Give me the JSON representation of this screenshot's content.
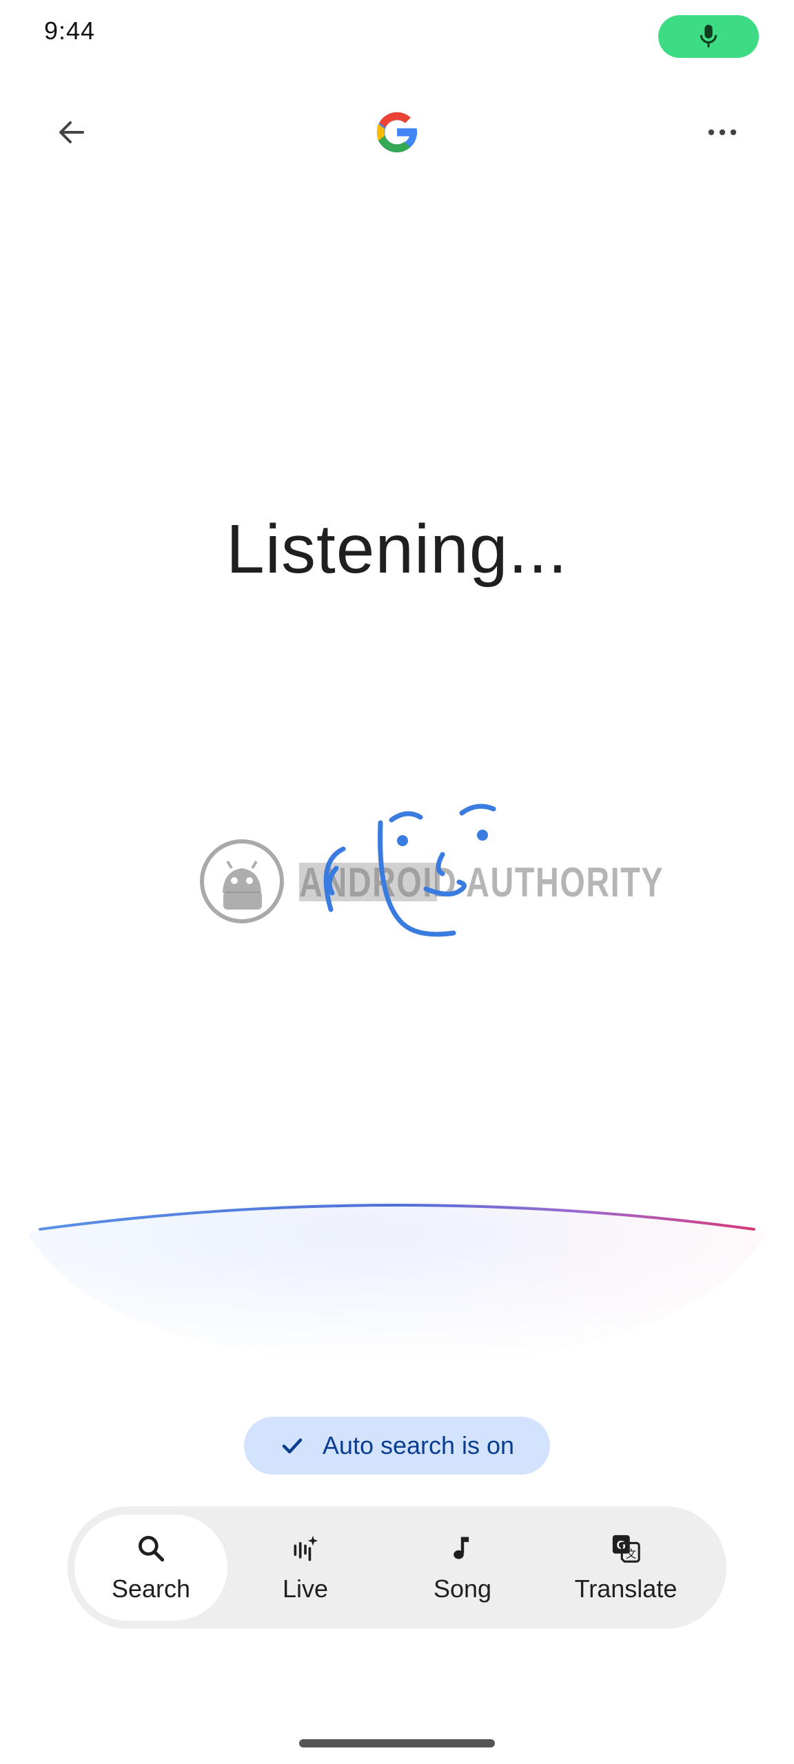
{
  "status_bar": {
    "time": "9:44",
    "mic_indicator_icon": "microphone-icon",
    "mic_indicator_color": "#3ddc84"
  },
  "app_bar": {
    "back_icon": "arrow-back-icon",
    "logo": "google-g-logo",
    "more_icon": "more-horizontal-icon"
  },
  "main": {
    "status_text": "Listening..."
  },
  "watermark": {
    "text": "ANDROID AUTHORITY"
  },
  "auto_search_chip": {
    "icon": "check-icon",
    "label": "Auto search is on",
    "background": "#d3e3fd",
    "text_color": "#0b3d91"
  },
  "modes": [
    {
      "label": "Search",
      "icon": "search-icon",
      "selected": true
    },
    {
      "label": "Live",
      "icon": "live-sparkle-icon",
      "selected": false
    },
    {
      "label": "Song",
      "icon": "music-note-icon",
      "selected": false
    },
    {
      "label": "Translate",
      "icon": "translate-icon",
      "selected": false
    }
  ],
  "colors": {
    "accent_blue": "#4285f4",
    "wave_end_pink": "#d63a7a"
  }
}
